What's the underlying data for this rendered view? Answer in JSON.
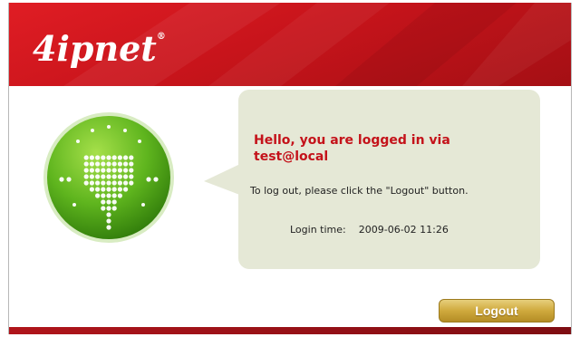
{
  "header": {
    "logo_text": "4ipnet",
    "logo_mark": "®",
    "brand_color": "#d3181f"
  },
  "icon": {
    "name": "globe-download-icon",
    "color": "#5fb51e"
  },
  "message": {
    "hello_line1": "Hello, you are logged in via",
    "hello_line2": "test@local",
    "instructions": "To log out, please click the \"Logout\" button.",
    "login_time_label": "Login time:",
    "login_time_value": "2009-06-02 11:26"
  },
  "actions": {
    "logout_label": "Logout"
  }
}
